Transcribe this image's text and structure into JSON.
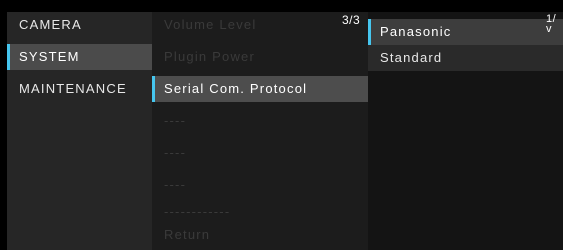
{
  "menu_main": {
    "items": [
      {
        "label": "CAMERA"
      },
      {
        "label": "SYSTEM"
      },
      {
        "label": "MAINTENANCE"
      }
    ]
  },
  "submenu": {
    "page_indicator": "3/3",
    "items": [
      {
        "label": "Volume Level"
      },
      {
        "label": "Plugin Power"
      },
      {
        "label": "Serial Com. Protocol"
      },
      {
        "label": "----"
      },
      {
        "label": "----"
      },
      {
        "label": "----"
      },
      {
        "label": "------------"
      },
      {
        "label": "Return"
      }
    ]
  },
  "options": {
    "page_indicator": "1/",
    "page_arrow": "v",
    "items": [
      {
        "label": "Panasonic"
      },
      {
        "label": "Standard"
      }
    ]
  },
  "colors": {
    "accent": "#46c6ef"
  }
}
